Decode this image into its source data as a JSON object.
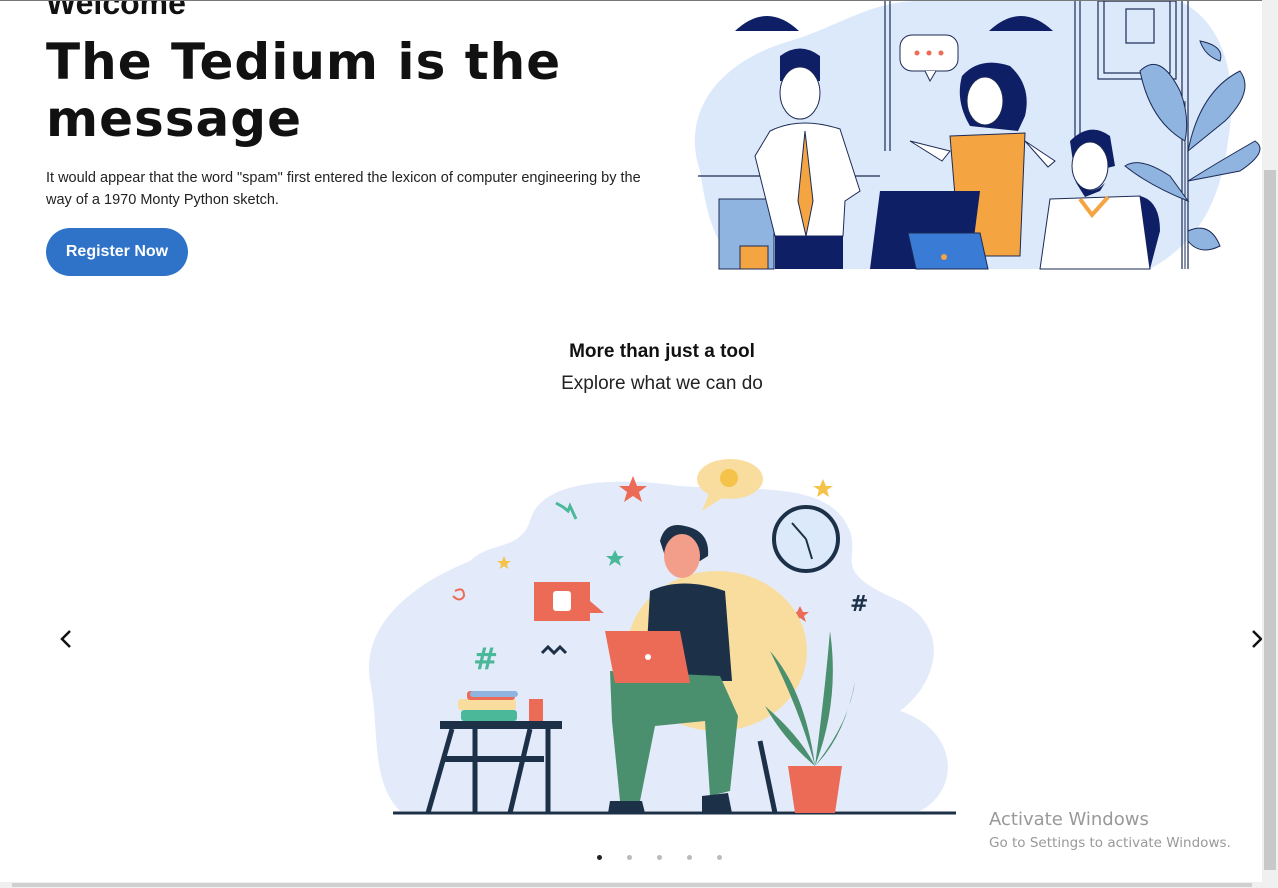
{
  "hero": {
    "welcome": "Welcome",
    "title": "The Tedium is the message",
    "description": "It would appear that the word \"spam\" first entered the lexicon of computer engineering by the way of a 1970 Monty Python sketch.",
    "cta_label": "Register Now"
  },
  "features": {
    "title": "More than just a tool",
    "subtitle": "Explore what we can do"
  },
  "carousel": {
    "prev_icon": "chevron-left-icon",
    "next_icon": "chevron-right-icon",
    "slide_count": 5,
    "active_index": 0
  },
  "watermark": {
    "line1": "Activate Windows",
    "line2": "Go to Settings to activate Windows."
  },
  "colors": {
    "primary_button": "#2f73c9",
    "illustration_blue": "#dce9fb",
    "accent_orange": "#f5a442",
    "accent_coral": "#ec6b56"
  }
}
